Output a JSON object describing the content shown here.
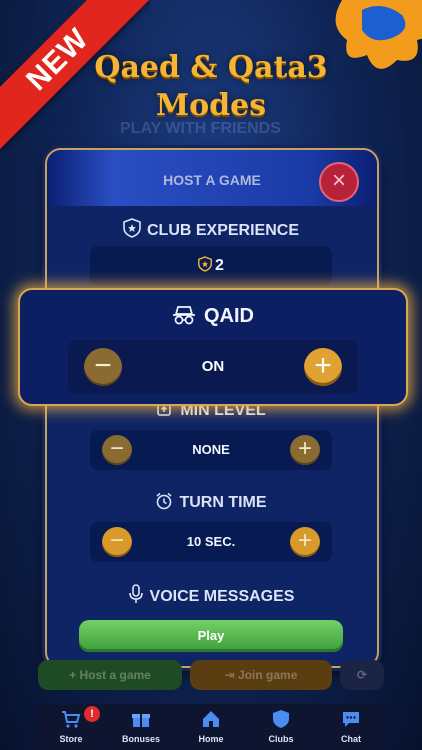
{
  "promo": {
    "ribbon": "NEW",
    "headline_line1": "Qaed & Qata3",
    "headline_line2": "Modes"
  },
  "background": {
    "friends_text": "PLAY WITH FRIENDS",
    "host_button": "Host a game",
    "join_button": "Join game"
  },
  "modal": {
    "title": "HOST A GAME",
    "close_icon": "close-icon",
    "club_experience": {
      "label": "CLUB EXPERIENCE",
      "value": "2",
      "icon": "shield-star-icon"
    },
    "qaid": {
      "label": "QAID",
      "value": "ON",
      "icon": "incognito-icon"
    },
    "min_level": {
      "label": "MIN LEVEL",
      "value": "NONE",
      "icon": "level-up-icon"
    },
    "turn_time": {
      "label": "TURN TIME",
      "value": "10 SEC.",
      "icon": "alarm-clock-icon"
    },
    "voice_messages": {
      "label": "VOICE MESSAGES",
      "icon": "microphone-icon"
    },
    "play_label": "Play"
  },
  "tabs": [
    {
      "label": "Store",
      "icon": "cart-icon"
    },
    {
      "label": "Bonuses",
      "icon": "gift-icon",
      "badge": "!"
    },
    {
      "label": "Home",
      "icon": "home-icon"
    },
    {
      "label": "Clubs",
      "icon": "shield-icon"
    },
    {
      "label": "Chat",
      "icon": "chat-bubble-icon"
    }
  ],
  "colors": {
    "accent_gold": "#f5b533",
    "primary_navy": "#0e2465",
    "play_green": "#4caf45",
    "close_red": "#b8213a"
  }
}
